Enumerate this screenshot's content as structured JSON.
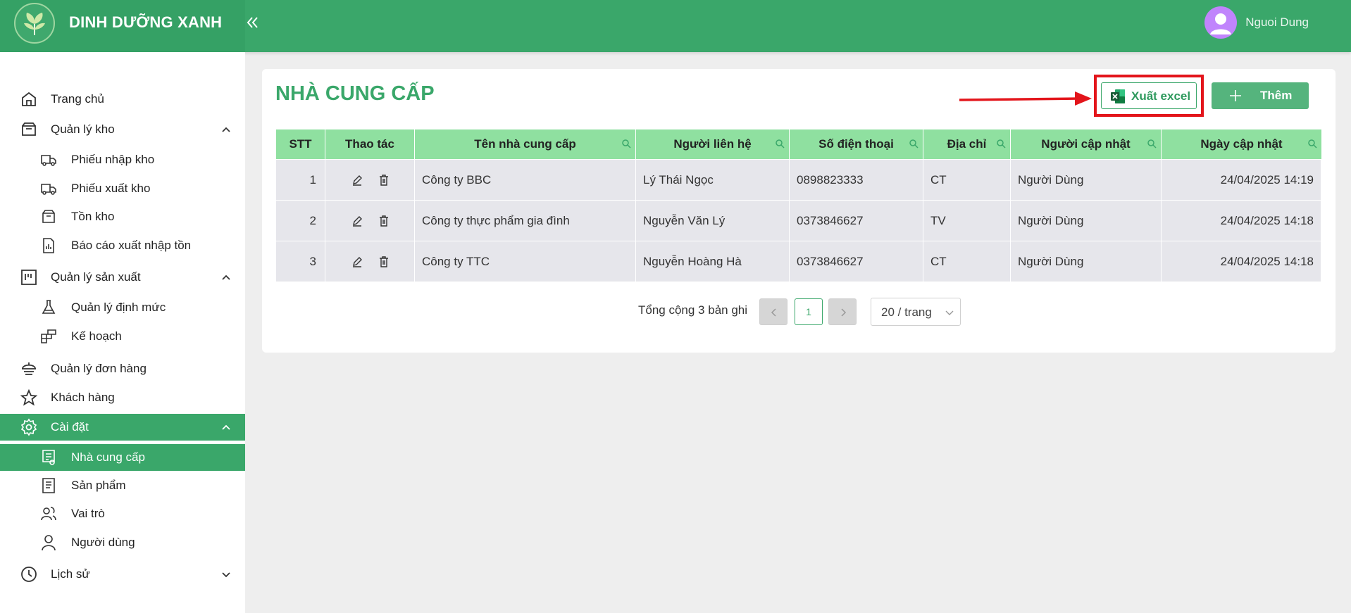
{
  "header": {
    "brand": "DINH DƯỠNG XANH",
    "user_name": "Nguoi Dung",
    "colors": {
      "primary": "#3aa76a",
      "avatar": "#c084fc"
    }
  },
  "sidebar": {
    "items": [
      {
        "label": "Trang chủ",
        "icon": "home-icon",
        "level": 1
      },
      {
        "label": "Quản lý kho",
        "icon": "box-icon",
        "level": 1,
        "expanded": true
      },
      {
        "label": "Phiếu nhập kho",
        "icon": "truck-in-icon",
        "level": 2
      },
      {
        "label": "Phiếu xuất kho",
        "icon": "truck-out-icon",
        "level": 2
      },
      {
        "label": "Tồn kho",
        "icon": "inventory-icon",
        "level": 2
      },
      {
        "label": "Báo cáo xuất nhập tồn",
        "icon": "report-icon",
        "level": 2
      },
      {
        "label": "Quản lý sản xuất",
        "icon": "factory-icon",
        "level": 1,
        "expanded": true
      },
      {
        "label": "Quản lý định mức",
        "icon": "flask-icon",
        "level": 2
      },
      {
        "label": "Kế hoạch",
        "icon": "plan-icon",
        "level": 2
      },
      {
        "label": "Quản lý đơn hàng",
        "icon": "orders-icon",
        "level": 1
      },
      {
        "label": "Khách hàng",
        "icon": "star-icon",
        "level": 1
      },
      {
        "label": "Cài đặt",
        "icon": "settings-icon",
        "level": 1,
        "expanded": true,
        "active": true
      },
      {
        "label": "Nhà cung cấp",
        "icon": "supplier-icon",
        "level": 2,
        "active": true
      },
      {
        "label": "Sản phẩm",
        "icon": "product-icon",
        "level": 2
      },
      {
        "label": "Vai trò",
        "icon": "role-icon",
        "level": 2
      },
      {
        "label": "Người dùng",
        "icon": "user-icon",
        "level": 2
      },
      {
        "label": "Lịch sử",
        "icon": "history-icon",
        "level": 1,
        "expanded": false
      }
    ]
  },
  "main": {
    "title": "NHÀ CUNG CẤP",
    "export_label": "Xuất excel",
    "add_label": "Thêm",
    "table": {
      "columns": [
        "STT",
        "Thao tác",
        "Tên nhà cung cấp",
        "Người liên hệ",
        "Số điện thoại",
        "Địa chỉ",
        "Người cập nhật",
        "Ngày cập nhật"
      ],
      "rows": [
        {
          "stt": "1",
          "name": "Công ty BBC",
          "contact": "Lý Thái Ngọc",
          "phone": "0898823333",
          "address": "CT",
          "updated_by": "Người Dùng",
          "updated_at": "24/04/2025 14:19"
        },
        {
          "stt": "2",
          "name": "Công ty thực phẩm gia đình",
          "contact": "Nguyễn Văn Lý",
          "phone": "0373846627",
          "address": "TV",
          "updated_by": "Người Dùng",
          "updated_at": "24/04/2025 14:18"
        },
        {
          "stt": "3",
          "name": "Công ty TTC",
          "contact": "Nguyễn Hoàng Hà",
          "phone": "0373846627",
          "address": "CT",
          "updated_by": "Người Dùng",
          "updated_at": "24/04/2025 14:18"
        }
      ]
    },
    "pagination": {
      "total_text": "Tổng cộng 3 bản ghi",
      "current_page": "1",
      "page_size": "20 / trang"
    }
  }
}
